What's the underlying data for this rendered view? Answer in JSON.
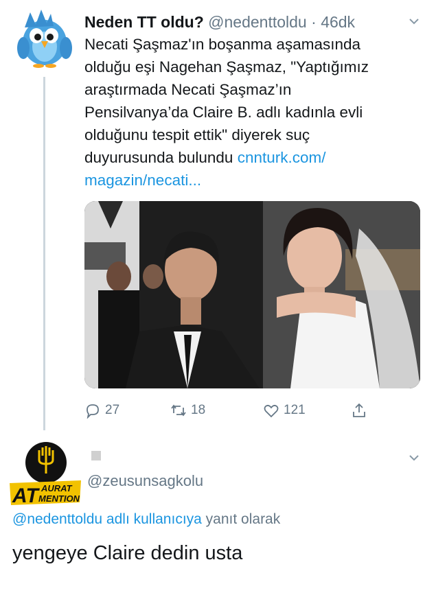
{
  "tweet": {
    "name": "Neden TT oldu?",
    "handle": "@nedenttoldu",
    "separator": "·",
    "time": "46dk",
    "text_lines": [
      "Necati Şaşmaz'ın boşanma aşamasında",
      "olduğu eşi Nagehan Şaşmaz, \"Yaptığımız",
      "araştırmada Necati Şaşmaz’ın",
      "Pensilvanya’da Claire B. adlı kadınla evli",
      "olduğunu tespit ettik\" diyerek suç"
    ],
    "last_line_text": "duyurusunda bulundu ",
    "link_part1": "cnnturk.com/",
    "link_part2": "magazin/necati...",
    "actions": {
      "reply_count": "27",
      "retweet_count": "18",
      "like_count": "121"
    }
  },
  "reply": {
    "avatar_text_line1": "AURAT",
    "avatar_text_line2": "MENTION",
    "avatar_prefix": "AT",
    "handle": "@zeusunsagkolu",
    "replying_mention": "@nedenttoldu adlı kullanıcıya",
    "replying_suffix": " yanıt olarak",
    "text": "yengeye Claire dedin usta"
  },
  "icons": {
    "avatar": "twitter-bird-avatar",
    "more": "chevron-down-icon",
    "reply": "reply-icon",
    "retweet": "retweet-icon",
    "like": "heart-icon",
    "share": "share-icon"
  },
  "colors": {
    "link": "#1b95e0",
    "muted": "#657786",
    "bird": "#4aa3df"
  }
}
